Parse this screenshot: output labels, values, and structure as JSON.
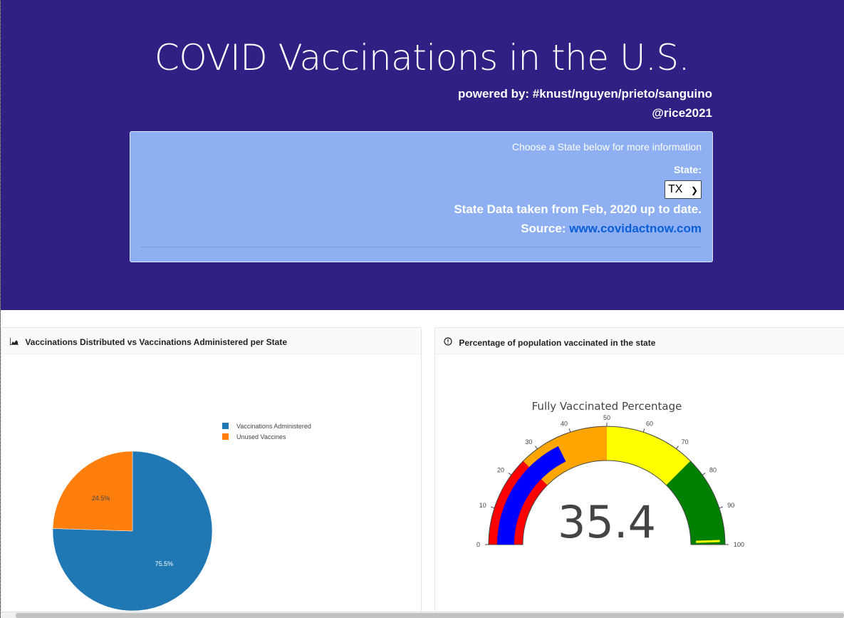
{
  "header": {
    "title": "COVID Vaccinations in the U.S.",
    "powered_by": "powered by: #knust/nguyen/prieto/sanguino",
    "handle": "@rice2021"
  },
  "selector_panel": {
    "hint": "Choose a State below for more information",
    "state_label": "State:",
    "state_value": "TX",
    "state_note": "State Data taken from Feb, 2020 up to date.",
    "source_label": "Source:",
    "source_link": "www.covidactnow.com"
  },
  "cards": {
    "distribution": {
      "title": "Vaccinations Distributed vs Vaccinations Administered per State",
      "icon": "area-chart-icon"
    },
    "percentage": {
      "title": "Percentage of population vaccinated in the state",
      "icon": "exclamation-circle-icon"
    }
  },
  "chart_data": [
    {
      "type": "pie",
      "labels": [
        "Vaccinations Administered",
        "Unused Vaccines"
      ],
      "values": [
        75.5,
        24.5
      ],
      "value_labels": [
        "75.5%",
        "24.5%"
      ],
      "colors": [
        "#1f77b4",
        "#ff7f0e"
      ],
      "legend": "top-right"
    },
    {
      "type": "gauge",
      "title": "Fully Vaccinated Percentage",
      "value": 35.4,
      "value_label": "35.4",
      "range": [
        0,
        100
      ],
      "ticks": [
        "0",
        "10",
        "20",
        "30",
        "40",
        "50",
        "60",
        "70",
        "80",
        "90",
        "100"
      ],
      "steps": [
        {
          "range": [
            0,
            25
          ],
          "color": "#ff0000"
        },
        {
          "range": [
            25,
            50
          ],
          "color": "#ffa500"
        },
        {
          "range": [
            50,
            75
          ],
          "color": "#ffff00"
        },
        {
          "range": [
            75,
            100
          ],
          "color": "#008000"
        }
      ],
      "bar_color": "#0000ff",
      "threshold": {
        "value": 99,
        "color": "#ffff00"
      }
    }
  ]
}
